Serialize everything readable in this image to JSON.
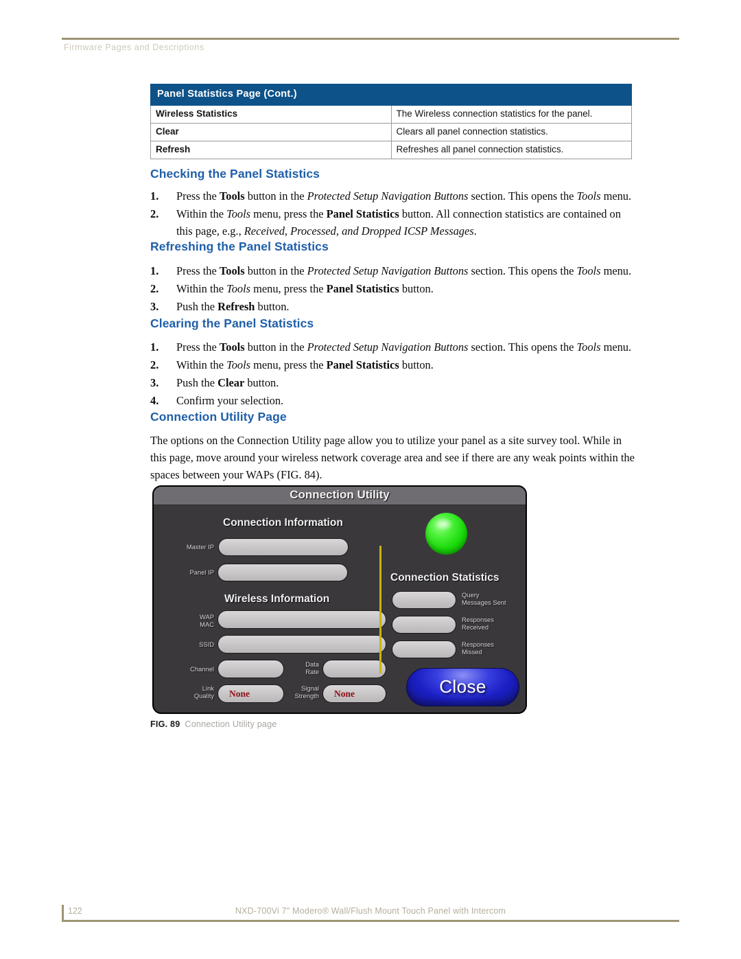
{
  "header": {
    "running_head": "Firmware Pages and Descriptions"
  },
  "table": {
    "title": "Panel Statistics Page (Cont.)",
    "rows": [
      {
        "term": "Wireless Statistics",
        "desc": "The Wireless connection statistics for the panel."
      },
      {
        "term": "Clear",
        "desc": "Clears all panel connection statistics."
      },
      {
        "term": "Refresh",
        "desc": "Refreshes all panel connection statistics."
      }
    ]
  },
  "sections": {
    "checking": {
      "heading": "Checking the Panel Statistics",
      "steps": [
        {
          "num": "1.",
          "html": "Press the <b>Tools</b> button in the <i>Protected Setup Navigation Buttons</i> section. This opens the <i>Tools</i> menu."
        },
        {
          "num": "2.",
          "html": "Within the <i>Tools</i> menu, press the <b>Panel Statistics</b> button. All connection statistics are contained on this page, e.g., <i>Received, Processed, and Dropped ICSP Messages</i>."
        }
      ]
    },
    "refreshing": {
      "heading": "Refreshing the Panel Statistics",
      "steps": [
        {
          "num": "1.",
          "html": "Press the <b>Tools</b> button in the <i>Protected Setup Navigation Buttons</i> section. This opens the <i>Tools</i> menu."
        },
        {
          "num": "2.",
          "html": "Within the <i>Tools</i> menu, press the <b>Panel Statistics</b> button."
        },
        {
          "num": "3.",
          "html": "Push the <b>Refresh</b> button."
        }
      ]
    },
    "clearing": {
      "heading": "Clearing the Panel Statistics",
      "steps": [
        {
          "num": "1.",
          "html": "Press the <b>Tools</b> button in the <i>Protected Setup Navigation Buttons</i> section. This opens the <i>Tools</i> menu."
        },
        {
          "num": "2.",
          "html": "Within the <i>Tools</i> menu, press the <b>Panel Statistics</b> button."
        },
        {
          "num": "3.",
          "html": "Push the <b>Clear</b> button."
        },
        {
          "num": "4.",
          "html": "Confirm your selection."
        }
      ]
    },
    "connection_utility": {
      "heading": "Connection Utility Page",
      "body": "The options on the Connection Utility page allow you to utilize your panel as a site survey tool. While in this page, move around your wireless network coverage area and see if there are any weak points within the spaces between your WAPs (FIG. 84)."
    }
  },
  "figure": {
    "caption_label": "FIG. 89",
    "caption_text": "Connection Utility page",
    "panel": {
      "title": "Connection Utility",
      "connection_information": {
        "heading": "Connection Information",
        "fields": [
          {
            "label": "Master IP",
            "value": ""
          },
          {
            "label": "Panel IP",
            "value": ""
          }
        ]
      },
      "wireless_information": {
        "heading": "Wireless Information",
        "fields": [
          {
            "label": "WAP\nMAC",
            "value": ""
          },
          {
            "label": "SSID",
            "value": ""
          },
          {
            "label": "Channel",
            "value": ""
          },
          {
            "label": "Data\nRate",
            "value": ""
          },
          {
            "label": "Link\nQuality",
            "value": "None"
          },
          {
            "label": "Signal\nStrength",
            "value": "None"
          }
        ],
        "label_wap_mac_l1": "WAP",
        "label_wap_mac_l2": "MAC",
        "label_ssid": "SSID",
        "label_channel": "Channel",
        "label_data_l1": "Data",
        "label_data_l2": "Rate",
        "label_link_l1": "Link",
        "label_link_l2": "Quality",
        "label_signal_l1": "Signal",
        "label_signal_l2": "Strength",
        "value_link_quality": "None",
        "value_signal_strength": "None"
      },
      "connection_statistics": {
        "heading": "Connection Statistics",
        "stats": [
          {
            "label_l1": "Query",
            "label_l2": "Messages Sent",
            "value": ""
          },
          {
            "label_l1": "Responses",
            "label_l2": "Received",
            "value": ""
          },
          {
            "label_l1": "Responses",
            "label_l2": "Missed",
            "value": ""
          }
        ]
      },
      "close_button": "Close",
      "status_led": "connected",
      "colors": {
        "panel_bg": "#3b383c",
        "titlebar": "#6f6d72",
        "led_green": "#17d707",
        "divider_yellow": "#c9b410",
        "close_blue": "#1b1fc4",
        "value_red": "#8f1016"
      }
    }
  },
  "footer": {
    "page_number": "122",
    "doc_title": "NXD-700Vi 7\" Modero® Wall/Flush Mount Touch Panel with Intercom"
  },
  "colors": {
    "heading_blue": "#1f5fa9",
    "table_header_blue": "#0d5289",
    "rule_tan": "#9c9474"
  }
}
